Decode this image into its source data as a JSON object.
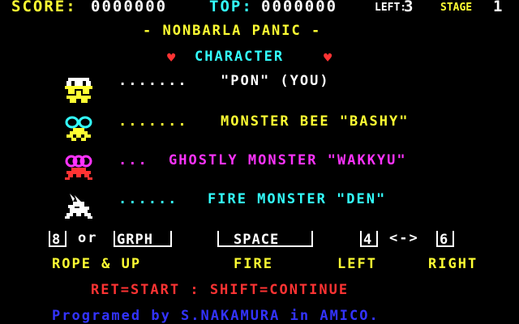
{
  "hud": {
    "score_label": "SCORE:",
    "score_value": "0000000",
    "top_label": "TOP:",
    "top_value": "0000000",
    "left_label": "LEFT:",
    "left_value": "3",
    "stage_label": "STAGE",
    "stage_value": "1"
  },
  "title": "- NONBARLA PANIC -",
  "section_heading": "CHARACTER",
  "heart_glyph": "♥",
  "characters": [
    {
      "dots": ".......",
      "name": "\"PON\" (YOU)",
      "icon": "pon-sprite",
      "color": "#ffffff"
    },
    {
      "dots": ".......",
      "name": "MONSTER BEE \"BASHY\"",
      "icon": "bee-sprite",
      "color": "#ffff33"
    },
    {
      "dots": "...",
      "name": "GHOSTLY MONSTER \"WAKKYU\"",
      "icon": "ghost-sprite",
      "color": "#ff33ff"
    },
    {
      "dots": "......",
      "name": "FIRE MONSTER \"DEN\"",
      "icon": "fire-sprite",
      "color": "#33ffff"
    }
  ],
  "controls": {
    "key_8": "8",
    "or_text": "or",
    "key_grph": "GRPH",
    "key_space": "SPACE",
    "key_4": "4",
    "arrow_text": "<->",
    "key_6": "6",
    "action_rope": "ROPE & UP",
    "action_fire": "FIRE",
    "action_left": "LEFT",
    "action_right": "RIGHT"
  },
  "start_text": "RET=START : SHIFT=CONTINUE",
  "credit_text": "Programed by S.NAKAMURA in AMICO.",
  "colors": {
    "background": "#000000",
    "hud_score": "#ffff33",
    "hud_top": "#33ffff",
    "hud_left": "#ffffff",
    "hud_stage": "#ffff33",
    "title": "#ffff33",
    "heading": "#33ffff",
    "heart": "#ff3333",
    "dots_pon": "#ffffff",
    "dots_bee": "#ffff33",
    "dots_ghost": "#ff33ff",
    "dots_fire": "#33ffff",
    "controls": "#ffffff",
    "actions": "#ffff33",
    "start": "#ff3333",
    "credit": "#3333ff"
  }
}
